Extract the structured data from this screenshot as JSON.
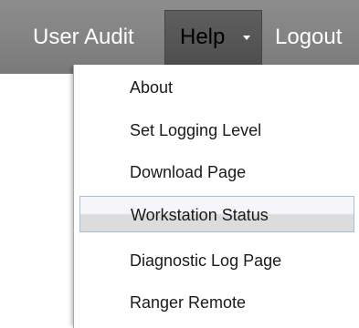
{
  "navbar": {
    "items": [
      {
        "label": "User Audit"
      },
      {
        "label": "Help"
      },
      {
        "label": "Logout"
      }
    ]
  },
  "help_menu": {
    "items": [
      {
        "label": "About"
      },
      {
        "label": "Set Logging Level"
      },
      {
        "label": "Download Page"
      },
      {
        "label": "Workstation Status",
        "highlighted": true
      },
      {
        "label": "Diagnostic Log Page"
      },
      {
        "label": "Ranger Remote"
      }
    ]
  },
  "colors": {
    "navbar_bg": "#808080",
    "active_menu_bg": "#555555",
    "highlight_border": "#a7bfdc"
  }
}
